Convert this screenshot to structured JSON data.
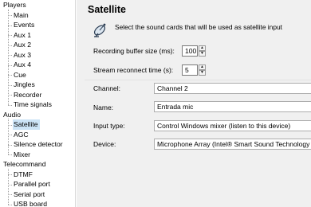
{
  "tree": {
    "categories": [
      {
        "label": "Players",
        "children": [
          "Main",
          "Events",
          "Aux 1",
          "Aux 2",
          "Aux 3",
          "Aux 4",
          "Cue",
          "Jingles",
          "Recorder",
          "Time signals"
        ]
      },
      {
        "label": "Audio",
        "children": [
          "Satellite",
          "AGC",
          "Silence detector",
          "Mixer"
        ]
      },
      {
        "label": "Telecommand",
        "children": [
          "DTMF",
          "Parallel port",
          "Serial port",
          "USB board"
        ]
      }
    ],
    "selected": "Satellite"
  },
  "page": {
    "title": "Satellite",
    "description": "Select the sound cards that will be used as satellite input",
    "icon": "satellite-dish-icon"
  },
  "form": {
    "buffer_label": "Recording buffer size (ms):",
    "buffer_value": "100",
    "reconnect_label": "Stream reconnect time (s):",
    "reconnect_value": "5",
    "channel_label": "Channel:",
    "channel_value": "Channel 2",
    "name_label": "Name:",
    "name_value": "Entrada mic",
    "input_type_label": "Input type:",
    "input_type_value": "Control Windows mixer (listen to this device)",
    "device_label": "Device:",
    "device_value": "Microphone Array (Intel® Smart Sound Technology"
  },
  "colors": {
    "selection": "#cce4f7",
    "panel": "#f0f0f0"
  }
}
